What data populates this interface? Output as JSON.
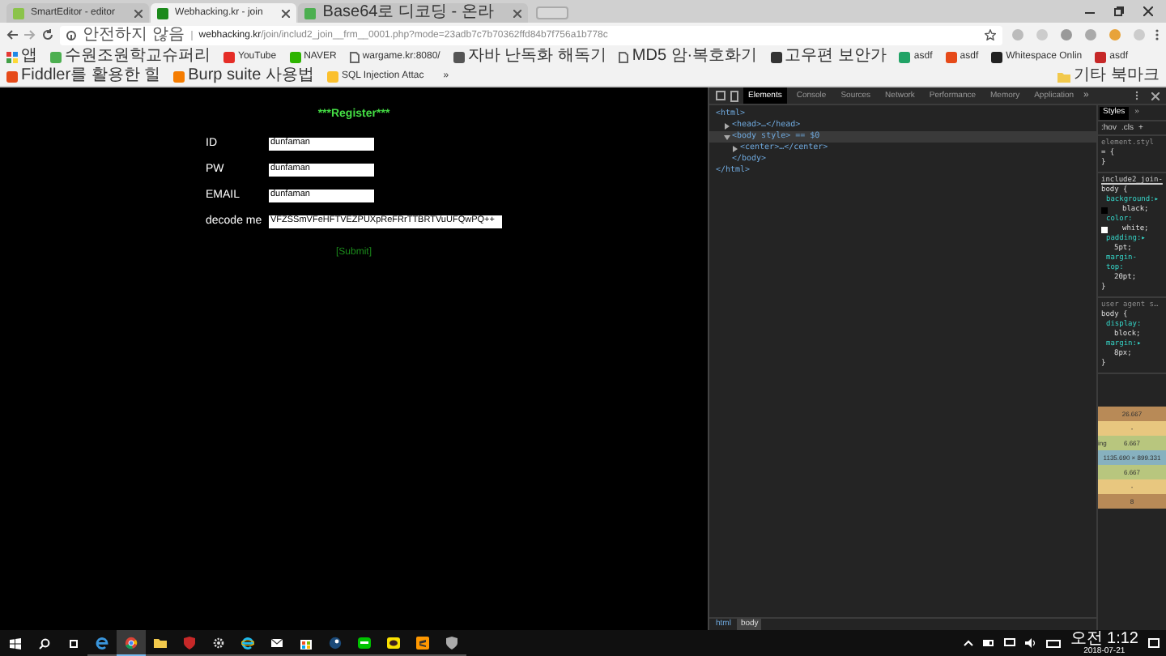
{
  "browser": {
    "tabs": [
      {
        "title": "SmartEditor - editor",
        "selected": false,
        "color": "#8bc34a"
      },
      {
        "title": "Webhacking.kr - join",
        "selected": true,
        "color": "#1b8a1b"
      },
      {
        "title": "Base64로 디코딩 - 온라",
        "selected": false,
        "color": "#4caf50"
      }
    ],
    "address": {
      "security": "안전하지 않음",
      "host": "webhacking.kr",
      "path": "/join/includ2_join__frm__0001.php?mode=23adb7c7b70362ffd84b7f756a1b778c"
    },
    "bookmarks": [
      {
        "label": "앱",
        "kind": "apps"
      },
      {
        "label": "수원조원학교슈퍼리",
        "kind": "favicon",
        "color": "#4caf50"
      },
      {
        "label": "YouTube",
        "kind": "favicon",
        "color": "#e52d27"
      },
      {
        "label": "NAVER",
        "kind": "favicon",
        "color": "#2db400"
      },
      {
        "label": "wargame.kr:8080/",
        "kind": "page"
      },
      {
        "label": "자바 난독화 해독기",
        "kind": "favicon",
        "color": "#555555"
      },
      {
        "label": "MD5 암·복호화기",
        "kind": "page"
      },
      {
        "label": "고우편 보안가",
        "kind": "favicon",
        "color": "#333333"
      },
      {
        "label": "asdf",
        "kind": "favicon",
        "color": "#21a366"
      },
      {
        "label": "asdf",
        "kind": "favicon",
        "color": "#e64a19"
      },
      {
        "label": "Whitespace Onlin",
        "kind": "favicon",
        "color": "#222222"
      },
      {
        "label": "asdf",
        "kind": "favicon",
        "color": "#c62828"
      },
      {
        "label": "Fiddler를 활용한 힐",
        "kind": "favicon",
        "color": "#e64a19"
      },
      {
        "label": "Burp suite 사용법",
        "kind": "favicon",
        "color": "#f57c00"
      },
      {
        "label": "SQL Injection Attac",
        "kind": "favicon",
        "color": "#fbc02d"
      },
      {
        "label": "»",
        "kind": "more"
      },
      {
        "label": "기타 북마크",
        "kind": "folder"
      }
    ]
  },
  "page": {
    "title": "***Register***",
    "fields": [
      {
        "label": "ID",
        "value": "dunfaman"
      },
      {
        "label": "PW",
        "value": "dunfaman"
      },
      {
        "label": "EMAIL",
        "value": "dunfaman"
      },
      {
        "label": "decode me",
        "value": "VFZSSmVFeHFTVEZPUXpReFRrTTBRTVuUFQwPQ++"
      }
    ],
    "submit": "[Submit]"
  },
  "devtools": {
    "tabs": [
      {
        "label": "Elements",
        "selected": true
      },
      {
        "label": "Console",
        "selected": false
      },
      {
        "label": "Sources",
        "selected": false
      },
      {
        "label": "Network",
        "selected": false
      },
      {
        "label": "Performance",
        "selected": false
      },
      {
        "label": "Memory",
        "selected": false
      },
      {
        "label": "Application",
        "selected": false
      }
    ],
    "more": "»",
    "tree": [
      {
        "text": "<html>",
        "children": [
          {
            "text": "<head>…</head>",
            "expanded": false
          },
          {
            "text": "<body style> == $0",
            "expanded": true,
            "selected": true,
            "children": [
              {
                "text": "<center>…</center>",
                "expanded": false
              },
              {
                "text": "</body>"
              }
            ]
          }
        ]
      },
      {
        "text": "</html>"
      }
    ],
    "styles_tabs": [
      {
        "label": "Styles",
        "selected": true
      },
      {
        "label": "»",
        "selected": false
      }
    ],
    "filters": [
      ":hov",
      ".cls",
      "+"
    ],
    "rules": [
      [
        {
          "text": "element.styl",
          "kind": "selector"
        },
        {
          "text": "= {",
          "kind": "plain"
        },
        {
          "text": "}",
          "kind": "plain"
        }
      ],
      [
        {
          "text": "include2_join-",
          "kind": "link"
        },
        {
          "text": "body {",
          "kind": "plain"
        },
        {
          "text": "background:▸",
          "kind": "prop"
        },
        {
          "text": "black;",
          "kind": "value",
          "color": "#000000"
        },
        {
          "text": "color:",
          "kind": "prop"
        },
        {
          "text": "white;",
          "kind": "value",
          "color": "#ffffff"
        },
        {
          "text": "padding:▸",
          "kind": "prop"
        },
        {
          "text": "5pt;",
          "kind": "value"
        },
        {
          "text": "margin-",
          "kind": "prop"
        },
        {
          "text": "top:",
          "kind": "prop"
        },
        {
          "text": "20pt;",
          "kind": "value"
        },
        {
          "text": "}",
          "kind": "plain"
        }
      ],
      [
        {
          "text": "user agent s…",
          "kind": "selector"
        },
        {
          "text": "body {",
          "kind": "plain"
        },
        {
          "text": "display:",
          "kind": "prop"
        },
        {
          "text": "block;",
          "kind": "value"
        },
        {
          "text": "margin:▸",
          "kind": "prop"
        },
        {
          "text": "8px;",
          "kind": "value"
        },
        {
          "text": "}",
          "kind": "plain"
        }
      ]
    ],
    "box_model": [
      {
        "value": "26.667",
        "color": "#b88a57"
      },
      {
        "value": "-",
        "color": "#e8c77f"
      },
      {
        "label": "ing",
        "value": "6.667",
        "color": "#b8c67e"
      },
      {
        "value": "1135.690 × 899.331",
        "color": "#87b1bf"
      },
      {
        "value": "6.667",
        "color": "#b8c67e"
      },
      {
        "value": "-",
        "color": "#e8c77f"
      },
      {
        "value": "8",
        "color": "#b88a57"
      }
    ],
    "breadcrumbs": [
      {
        "label": "html",
        "selected": false
      },
      {
        "label": "body",
        "selected": true
      }
    ]
  },
  "taskbar": {
    "apps": [
      {
        "kind": "edge",
        "active": false
      },
      {
        "kind": "chrome",
        "active": true
      },
      {
        "kind": "folder",
        "active": false
      },
      {
        "kind": "shield",
        "active": false
      },
      {
        "kind": "gear",
        "active": false
      },
      {
        "kind": "ie",
        "active": false
      },
      {
        "kind": "mail",
        "active": false
      },
      {
        "kind": "store",
        "active": false
      },
      {
        "kind": "steam",
        "active": false
      },
      {
        "kind": "chat",
        "active": false
      },
      {
        "kind": "talk",
        "active": false
      },
      {
        "kind": "sublime",
        "active": false
      },
      {
        "kind": "shield2",
        "active": false
      }
    ],
    "time": "오전 1:12",
    "date": "2018-07-21"
  }
}
